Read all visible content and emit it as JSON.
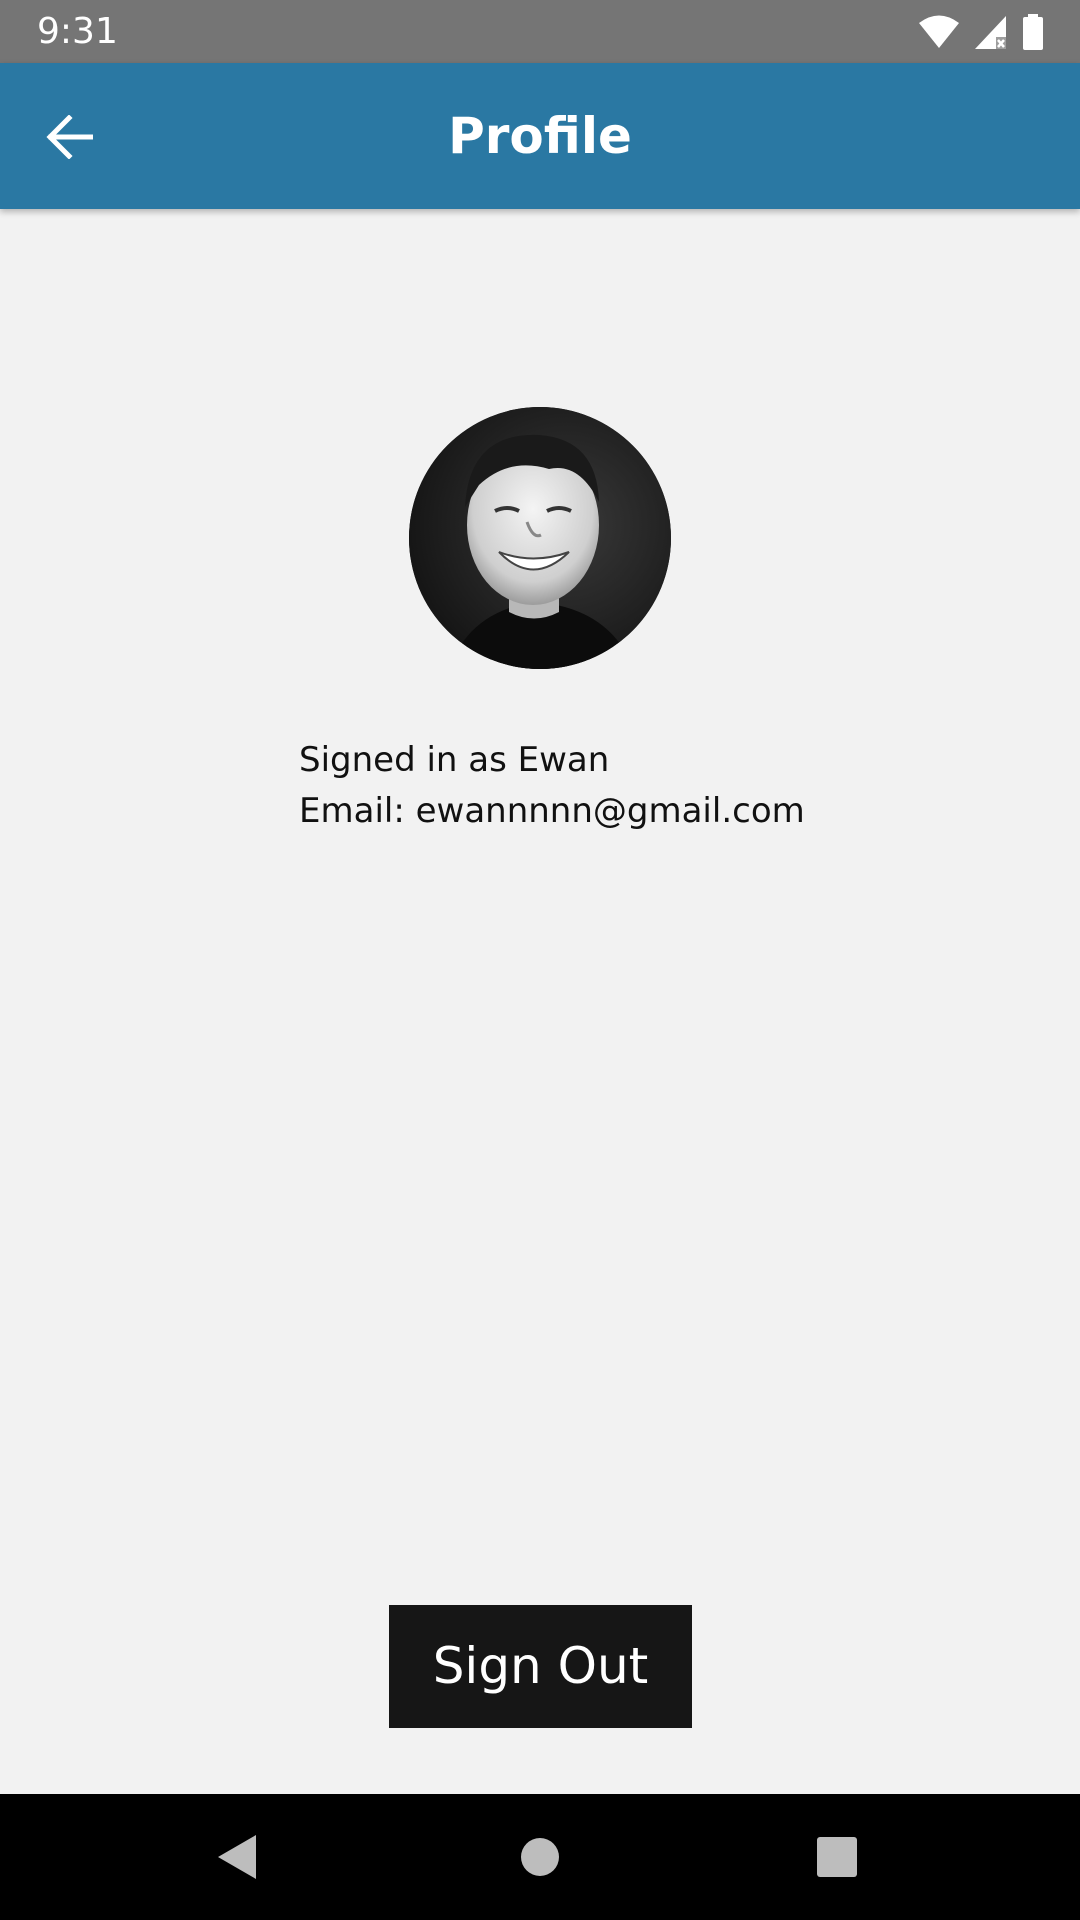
{
  "status_bar": {
    "time": "9:31",
    "icons": [
      "wifi-icon",
      "signal-icon",
      "battery-icon"
    ]
  },
  "app_bar": {
    "title": "Profile",
    "back_icon": "arrow-back-icon",
    "background": "#2a78a3"
  },
  "profile": {
    "avatar_icon": "user-avatar-photo",
    "signed_in_text": "Signed in as Ewan",
    "email_text": "Email: ewannnnn@gmail.com"
  },
  "actions": {
    "sign_out_label": "Sign Out"
  },
  "nav_bar": {
    "icons": [
      "nav-back-icon",
      "nav-home-icon",
      "nav-recents-icon"
    ]
  },
  "colors": {
    "background": "#f2f2f2",
    "status_bar": "#757575",
    "button": "#161616"
  }
}
